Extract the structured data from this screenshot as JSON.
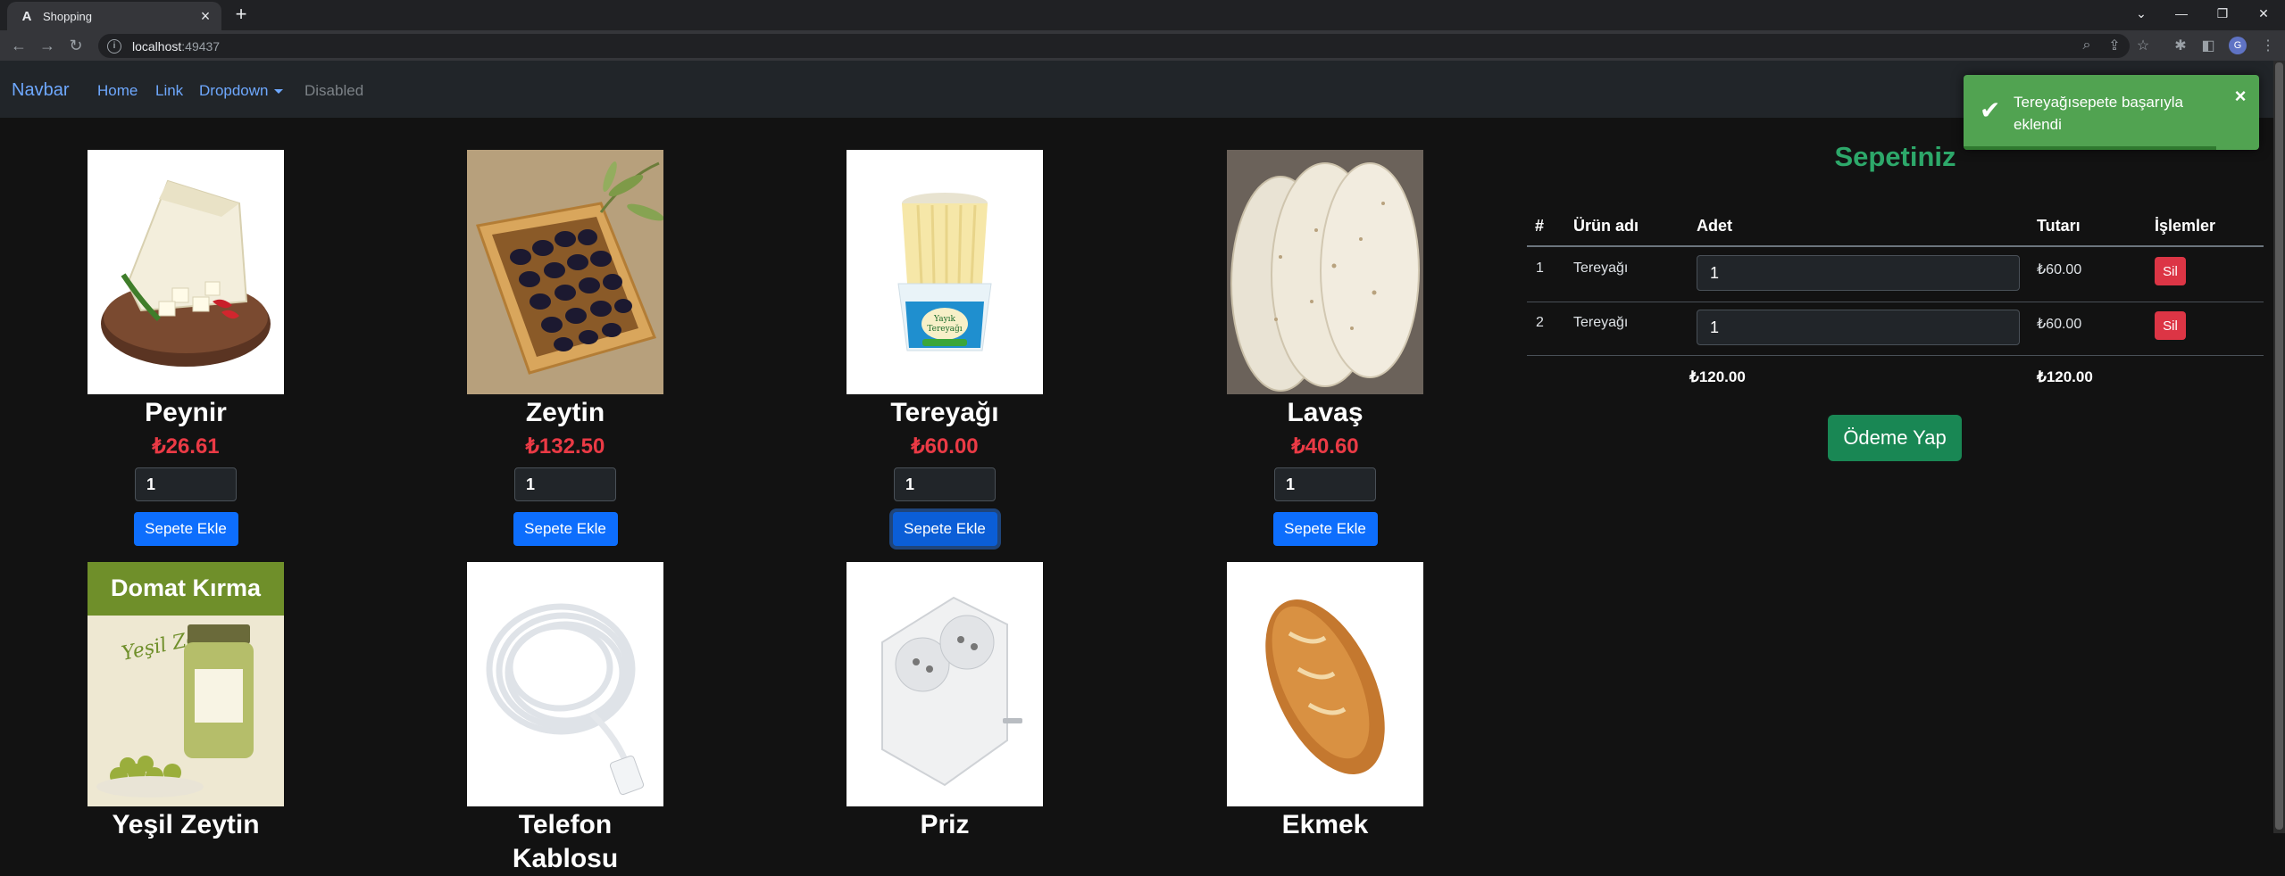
{
  "browser": {
    "tab_title": "Shopping",
    "tab_favicon": "A",
    "url_host": "localhost",
    "url_port": ":49437",
    "profile_initial": "G"
  },
  "navbar": {
    "brand": "Navbar",
    "links": [
      "Home",
      "Link",
      "Dropdown",
      "Disabled"
    ]
  },
  "products": [
    {
      "name": "Peynir",
      "price": "₺26.61",
      "qty": "1",
      "button": "Sepete Ekle",
      "icon": "cheese-image"
    },
    {
      "name": "Zeytin",
      "price": "₺132.50",
      "qty": "1",
      "button": "Sepete Ekle",
      "icon": "olives-image"
    },
    {
      "name": "Tereyağı",
      "price": "₺60.00",
      "qty": "1",
      "button": "Sepete Ekle",
      "icon": "butter-image"
    },
    {
      "name": "Lavaş",
      "price": "₺40.60",
      "qty": "1",
      "button": "Sepete Ekle",
      "icon": "flatbread-image"
    },
    {
      "name": "Yeşil Zeytin",
      "image_text": "Domat Kırma",
      "image_script": "Yeşil Zeytin",
      "icon": "green-olives-jar-image"
    },
    {
      "name": "Telefon Kablosu",
      "icon": "phone-cable-image"
    },
    {
      "name": "Priz",
      "icon": "power-socket-image"
    },
    {
      "name": "Ekmek",
      "icon": "bread-image"
    }
  ],
  "cart": {
    "title": "Sepetiniz",
    "headers": [
      "#",
      "Ürün adı",
      "Adet",
      "Tutarı",
      "İşlemler"
    ],
    "rows": [
      {
        "no": "1",
        "name": "Tereyağı",
        "qty": "1",
        "amount": "₺60.00",
        "action": "Sil"
      },
      {
        "no": "2",
        "name": "Tereyağı",
        "qty": "1",
        "amount": "₺60.00",
        "action": "Sil"
      }
    ],
    "total_qty_col": "₺120.00",
    "total_amount": "₺120.00",
    "pay_button": "Ödeme Yap"
  },
  "toast": {
    "message": "Tereyağısepete başarıyla eklendi",
    "color": "#51a351"
  }
}
